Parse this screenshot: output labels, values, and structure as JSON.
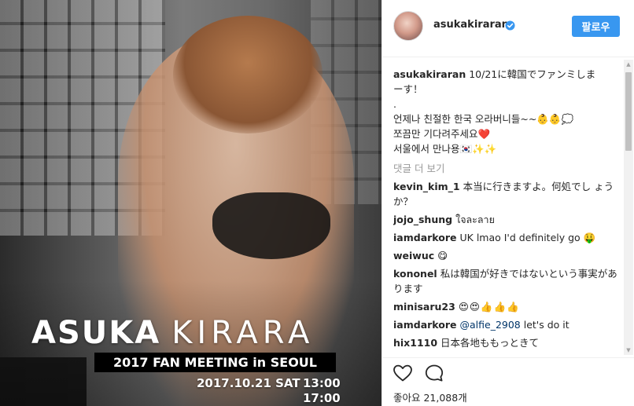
{
  "poster": {
    "title_bold": "ASUKA",
    "title_thin": "KIRARA",
    "banner": "2017 FAN MEETING in SEOUL",
    "date": "2017.10.21 SAT",
    "times": [
      "13:00",
      "17:00"
    ]
  },
  "post": {
    "username": "asukakiraran",
    "verified": true,
    "follow_label": "팔로우",
    "caption": {
      "username": "asukakiraran",
      "lines": [
        "10/21に韓国でファンミしま",
        "ーす！",
        ".",
        "언제나 친절한 한국 오라버니들~~👶👶💭",
        "쪼끔만 기다려주세요❤️",
        "서울에서 만나용🇰🇷✨✨"
      ]
    },
    "load_more_label": "댓글 더 보기",
    "comments": [
      {
        "username": "kevin_kim_1",
        "text": "本当に行きますよ。何処でし ょうか？"
      },
      {
        "username": "jojo_shung",
        "text": "ใจละลาย"
      },
      {
        "username": "iamdarkore",
        "text": "UK lmao I'd definitely go 🤑"
      },
      {
        "username": "weiwuc",
        "text": "😋"
      },
      {
        "username": "kononel",
        "text": "私は韓国が好きではないという事実があります"
      },
      {
        "username": "minisaru23",
        "text": "😍😍👍👍👍"
      },
      {
        "username": "iamdarkore",
        "mention": "@alfie_2908",
        "text": " let's do it"
      },
      {
        "username": "hix1110",
        "text": "日本各地ももっときて"
      }
    ],
    "likes_label": "좋아요 21,088개"
  },
  "icons": {
    "verified": "verified-badge-icon",
    "heart": "heart-icon",
    "comment": "comment-icon"
  },
  "colors": {
    "accent": "#3897f0",
    "muted": "#999999",
    "mention": "#003569"
  }
}
